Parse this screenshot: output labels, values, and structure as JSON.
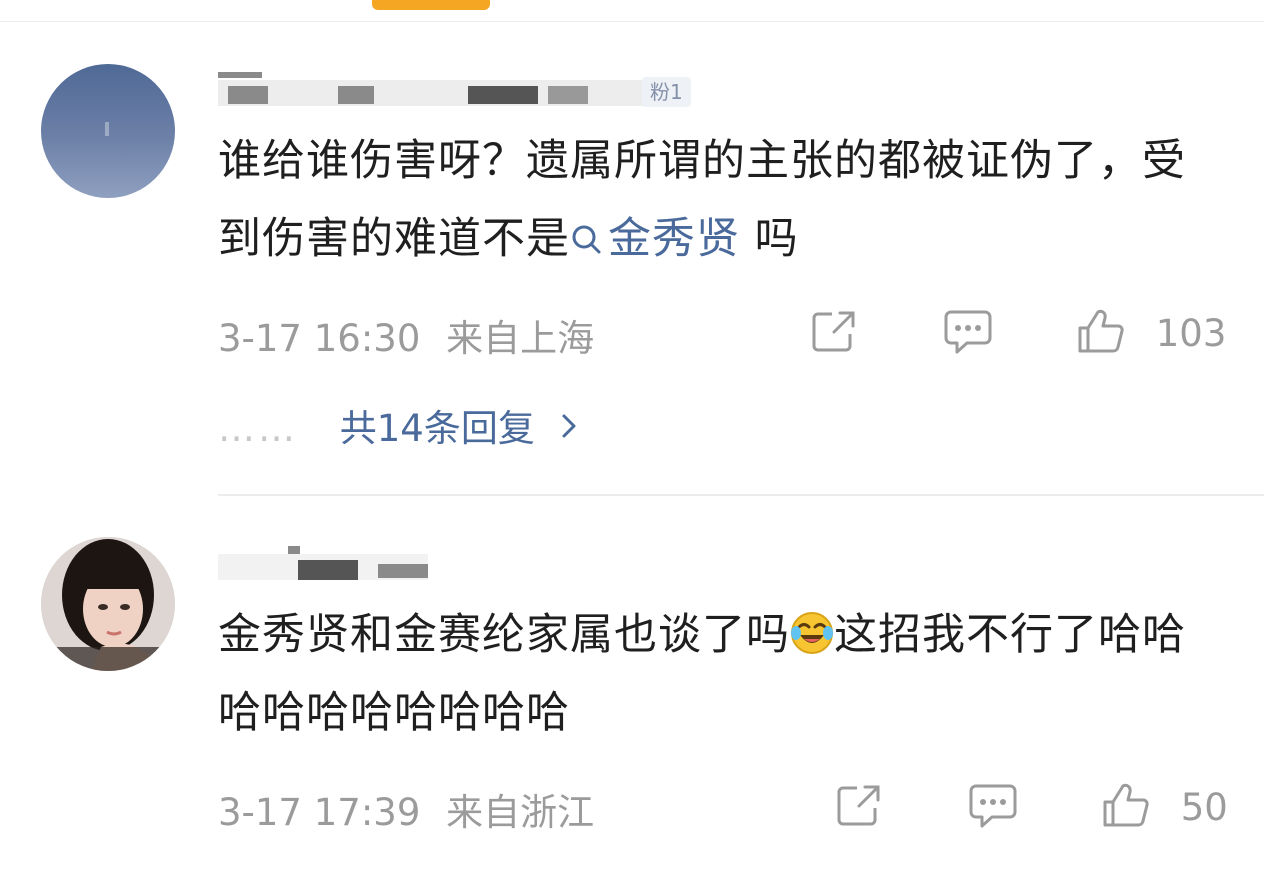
{
  "comments": [
    {
      "fan_badge": "粉1",
      "text_before": "谁给谁伤害呀？遗属所谓的主张的都被证伪了，受到伤害的难道不是",
      "topic": "金秀贤",
      "text_after": " 吗",
      "time": "3-17 16:30",
      "location": "来自上海",
      "likes": "103",
      "replies": "共14条回复"
    },
    {
      "text_before": "金秀贤和金赛纶家属也谈了吗",
      "text_after": "这招我不行了哈哈哈哈哈哈哈哈哈哈",
      "emoji": "laugh-cry-emoji",
      "time": "3-17 17:39",
      "location": "来自浙江",
      "likes": "50"
    }
  ],
  "colors": {
    "accent": "#f5a623",
    "link": "#4a6a9c",
    "meta": "#9b9b9b"
  }
}
